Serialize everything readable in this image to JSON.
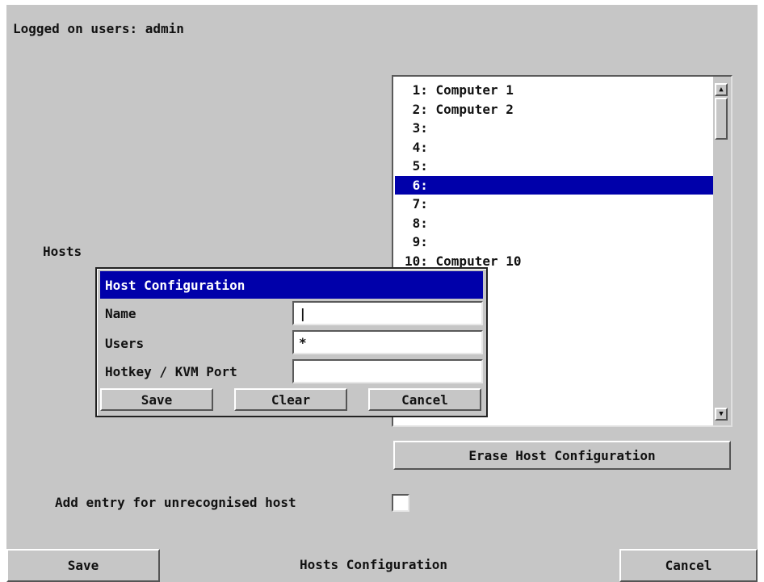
{
  "header": {
    "logged_on_users": "Logged on users:  admin"
  },
  "hosts_label": "Hosts",
  "host_list": {
    "rows": [
      {
        "text": " 1: Computer 1",
        "selected": false
      },
      {
        "text": " 2: Computer 2",
        "selected": false
      },
      {
        "text": " 3:",
        "selected": false
      },
      {
        "text": " 4:",
        "selected": false
      },
      {
        "text": " 5:",
        "selected": false
      },
      {
        "text": " 6:",
        "selected": true
      },
      {
        "text": " 7:",
        "selected": false
      },
      {
        "text": " 8:",
        "selected": false
      },
      {
        "text": " 9:",
        "selected": false
      },
      {
        "text": "10: Computer 10",
        "selected": false
      }
    ],
    "scroll_up_icon": "up-arrow",
    "scroll_down_icon": "down-arrow"
  },
  "erase_button": "Erase Host Configuration",
  "dialog": {
    "title": "Host Configuration",
    "name_label": "Name",
    "name_value": "|",
    "users_label": "Users",
    "users_value": "*",
    "hotkey_label": "Hotkey / KVM Port",
    "hotkey_value": "",
    "save": "Save",
    "clear": "Clear",
    "cancel": "Cancel"
  },
  "unrecognised": {
    "label": "Add entry for unrecognised host",
    "checked": false
  },
  "footer": {
    "save": "Save",
    "title": "Hosts Configuration",
    "cancel": "Cancel"
  },
  "colors": {
    "background": "#c6c6c6",
    "selection": "#0000aa"
  }
}
